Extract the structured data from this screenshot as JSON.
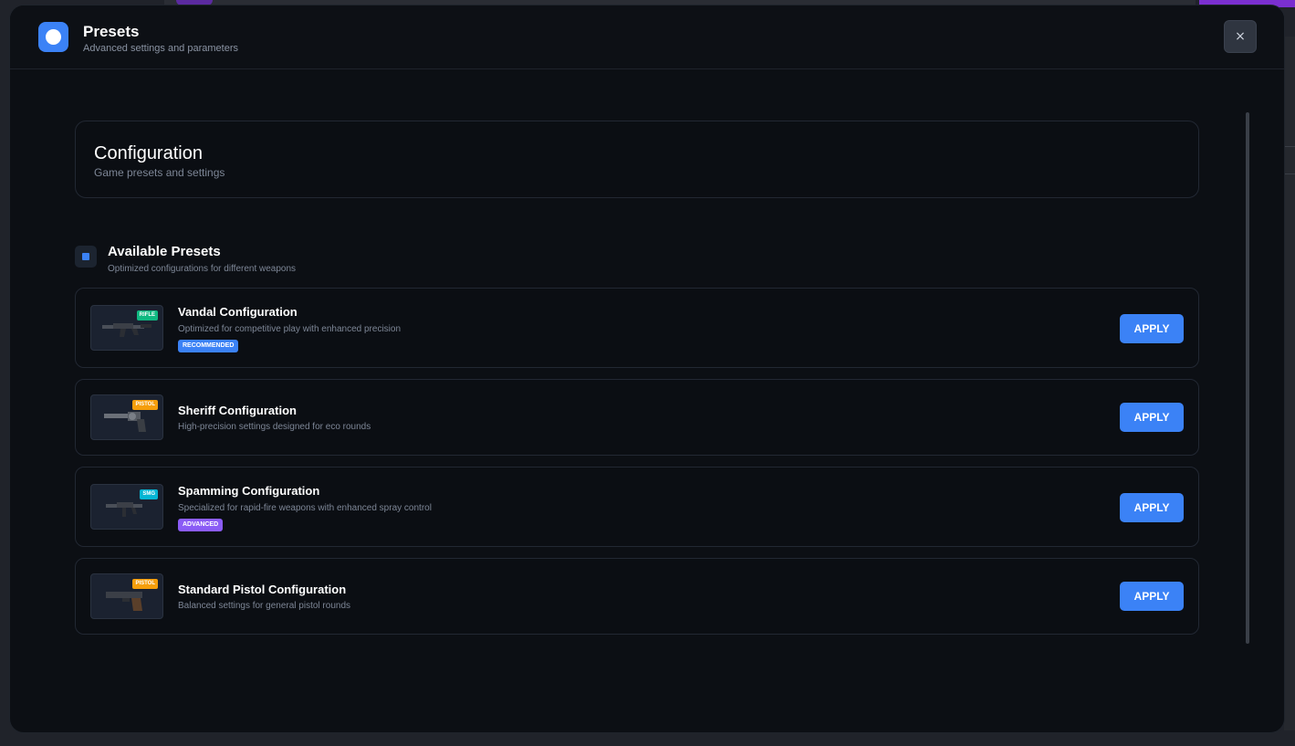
{
  "colors": {
    "accent": "#3b82f6",
    "modal_bg": "#0c0f14",
    "tag_rifle": "#10b981",
    "tag_pistol": "#f59e0b",
    "tag_smg": "#06b6d4",
    "badge_recommended": "#3b82f6",
    "badge_advanced": "#8b5cf6"
  },
  "header": {
    "title": "Presets",
    "subtitle": "Advanced settings and parameters",
    "close_icon": "×"
  },
  "config": {
    "title": "Configuration",
    "subtitle": "Game presets and settings"
  },
  "section": {
    "title": "Available Presets",
    "subtitle": "Optimized configurations for different weapons"
  },
  "presets": [
    {
      "name": "Vandal Configuration",
      "description": "Optimized for competitive play with enhanced precision",
      "tag": "RIFLE",
      "badge": "RECOMMENDED",
      "icon": "rifle-icon",
      "apply_label": "APPLY"
    },
    {
      "name": "Sheriff Configuration",
      "description": "High-precision settings designed for eco rounds",
      "tag": "PISTOL",
      "badge": "",
      "icon": "revolver-icon",
      "apply_label": "APPLY"
    },
    {
      "name": "Spamming Configuration",
      "description": "Specialized for rapid-fire weapons with enhanced spray control",
      "tag": "SMG",
      "badge": "ADVANCED",
      "icon": "smg-icon",
      "apply_label": "APPLY"
    },
    {
      "name": "Standard Pistol Configuration",
      "description": "Balanced settings for general pistol rounds",
      "tag": "PISTOL",
      "badge": "",
      "icon": "pistol-icon",
      "apply_label": "APPLY"
    }
  ]
}
